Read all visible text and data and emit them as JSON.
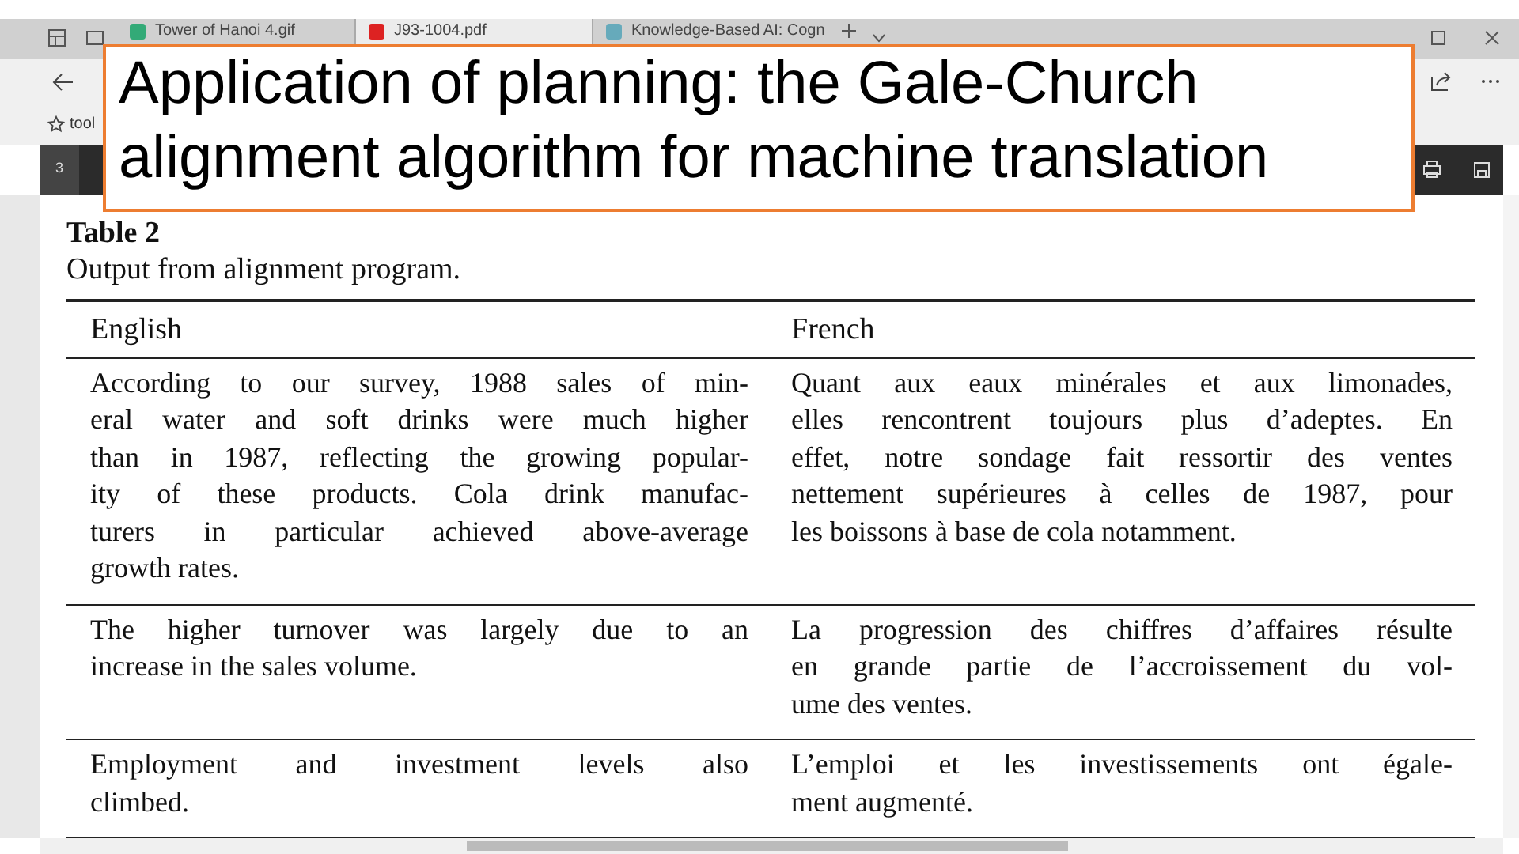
{
  "slide_title": "Application of planning: the Gale-Church alignment algorithm for machine translation",
  "tabs": [
    {
      "label": "Tower of Hanoi 4.gif",
      "selected": false
    },
    {
      "label": "J93-1004.pdf",
      "selected": true
    },
    {
      "label": "Knowledge-Based AI: Cogn",
      "selected": false
    }
  ],
  "favorites": [
    "tool"
  ],
  "pdf_toolbar": {
    "page": "3"
  },
  "document": {
    "table_title": "Table 2",
    "caption": "Output from alignment program.",
    "columns": [
      "English",
      "French"
    ],
    "rows": [
      [
        [
          "According to our survey, 1988 sales of min-",
          "eral water and soft drinks were much higher",
          "than in 1987, reflecting the growing popular-",
          "ity of these products. Cola drink manufac-",
          "turers in particular achieved above-average",
          "growth rates."
        ],
        [
          "Quant aux eaux minérales et aux limonades,",
          "elles rencontrent toujours plus d’adeptes. En",
          "effet, notre sondage fait ressortir des ventes",
          "nettement supérieures à celles de 1987, pour",
          "les boissons à base de cola notamment."
        ]
      ],
      [
        [
          "The higher turnover was largely due to an",
          "increase in the sales volume."
        ],
        [
          "La progression des chiffres d’affaires résulte",
          "en grande partie de l’accroissement du vol-",
          "ume des ventes."
        ]
      ],
      [
        [
          "Employment and investment levels also",
          "climbed."
        ],
        [
          "L’emploi et les investissements ont égale-",
          "ment augmenté."
        ]
      ]
    ]
  }
}
